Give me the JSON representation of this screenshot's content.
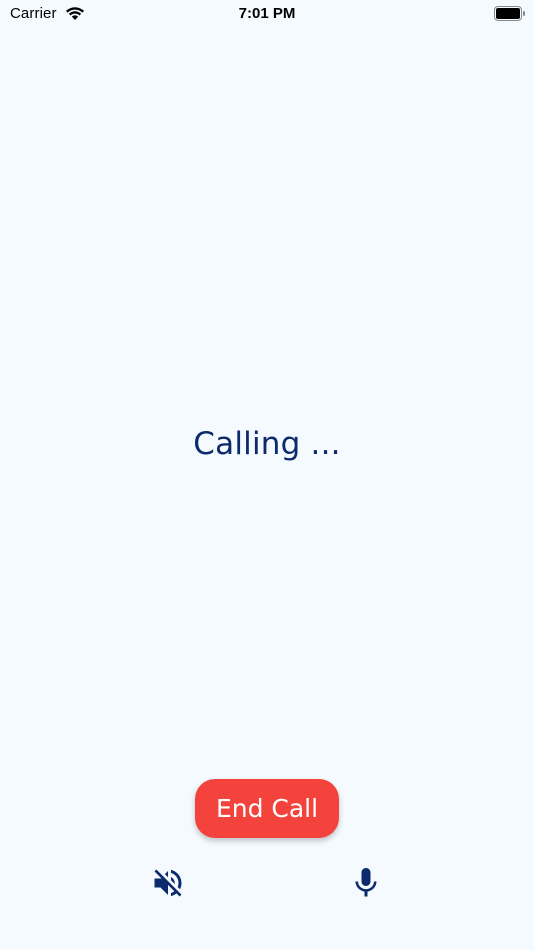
{
  "status_bar": {
    "carrier": "Carrier",
    "time": "7:01 PM"
  },
  "call": {
    "status_text": "Calling ...",
    "end_call_label": "End Call"
  },
  "controls": {
    "speaker_icon": "speaker-muted-icon",
    "mic_icon": "microphone-icon"
  },
  "colors": {
    "background": "#f5faff",
    "primary_text": "#0d2a6c",
    "end_call_button": "#f4433c",
    "end_call_text": "#ffffff"
  }
}
